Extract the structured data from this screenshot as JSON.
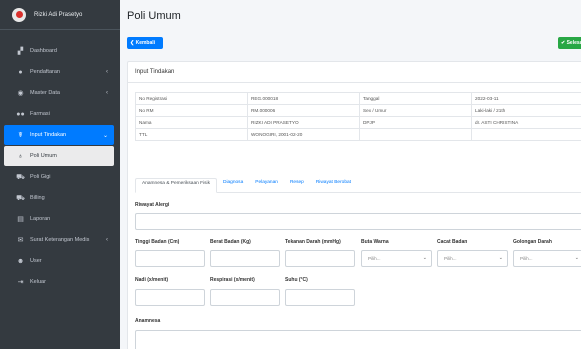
{
  "brand": {
    "name": "Rizki Adi Prasetyo"
  },
  "sidebar": {
    "items": [
      {
        "label": "Dashboard",
        "icon": "dashboard-icon",
        "glyph": "▞",
        "chev": ""
      },
      {
        "label": "Pendaftaran",
        "icon": "person-icon",
        "glyph": "●",
        "chev": "‹"
      },
      {
        "label": "Master Data",
        "icon": "database-icon",
        "glyph": "◉",
        "chev": "‹"
      },
      {
        "label": "Farmasi",
        "icon": "pills-icon",
        "glyph": "●●",
        "chev": ""
      },
      {
        "label": "Input Tindakan",
        "icon": "stethoscope-icon",
        "glyph": "☤",
        "chev": "⌄"
      },
      {
        "label": "Poli Umum",
        "icon": "user-doctor-icon",
        "glyph": "♁",
        "chev": ""
      },
      {
        "label": "Poli Gigi",
        "icon": "cart-icon",
        "glyph": "⛟",
        "chev": ""
      },
      {
        "label": "Billing",
        "icon": "cart-icon",
        "glyph": "⛟",
        "chev": ""
      },
      {
        "label": "Laporan",
        "icon": "file-icon",
        "glyph": "▤",
        "chev": ""
      },
      {
        "label": "Surat Keterangan Medis",
        "icon": "envelope-icon",
        "glyph": "✉",
        "chev": "‹"
      },
      {
        "label": "User",
        "icon": "users-icon",
        "glyph": "☻",
        "chev": ""
      },
      {
        "label": "Keluar",
        "icon": "logout-icon",
        "glyph": "⇥",
        "chev": ""
      }
    ]
  },
  "page": {
    "title": "Poli Umum",
    "back_label": "❮ Kembali",
    "save_label": "✔ Selesai"
  },
  "card": {
    "header": "Input Tindakan"
  },
  "info": {
    "rows": [
      [
        "No Registrasi",
        "REG.000018",
        "Tanggal",
        "2022-03-11"
      ],
      [
        "No RM",
        "RM.000006",
        "Sex / Umur",
        "Laki-laki / 21th"
      ],
      [
        "Nama",
        "RIZKI ADI PRASETYO",
        "DPJP",
        "dr. ASTI CHRISTINA"
      ],
      [
        "TTL",
        "WONOGIRI, 2001-02-20",
        "",
        ""
      ]
    ]
  },
  "tabs": [
    {
      "label": "Anamnesa & Pemeriksaan Fisik",
      "active": true
    },
    {
      "label": "Diagnosa",
      "active": false
    },
    {
      "label": "Pelayanan",
      "active": false
    },
    {
      "label": "Resep",
      "active": false
    },
    {
      "label": "Riwayat Berobat",
      "active": false
    }
  ],
  "form": {
    "riwayat_alergi": "Riwayat Alergi",
    "tinggi_badan": "Tinggi Badan (Cm)",
    "berat_badan": "Berat Badan (Kg)",
    "tekanan_darah": "Tekanan Darah (mmHg)",
    "buta_warna": "Buta Warna",
    "cacat_badan": "Cacat Badan",
    "golongan_darah": "Golongan Darah",
    "nadi": "Nadi (x/menit)",
    "respirasi": "Respirasi (x/menit)",
    "suhu": "Suhu (°C)",
    "anamnesa": "Anamnesa",
    "select_placeholder": "Pilih..."
  }
}
